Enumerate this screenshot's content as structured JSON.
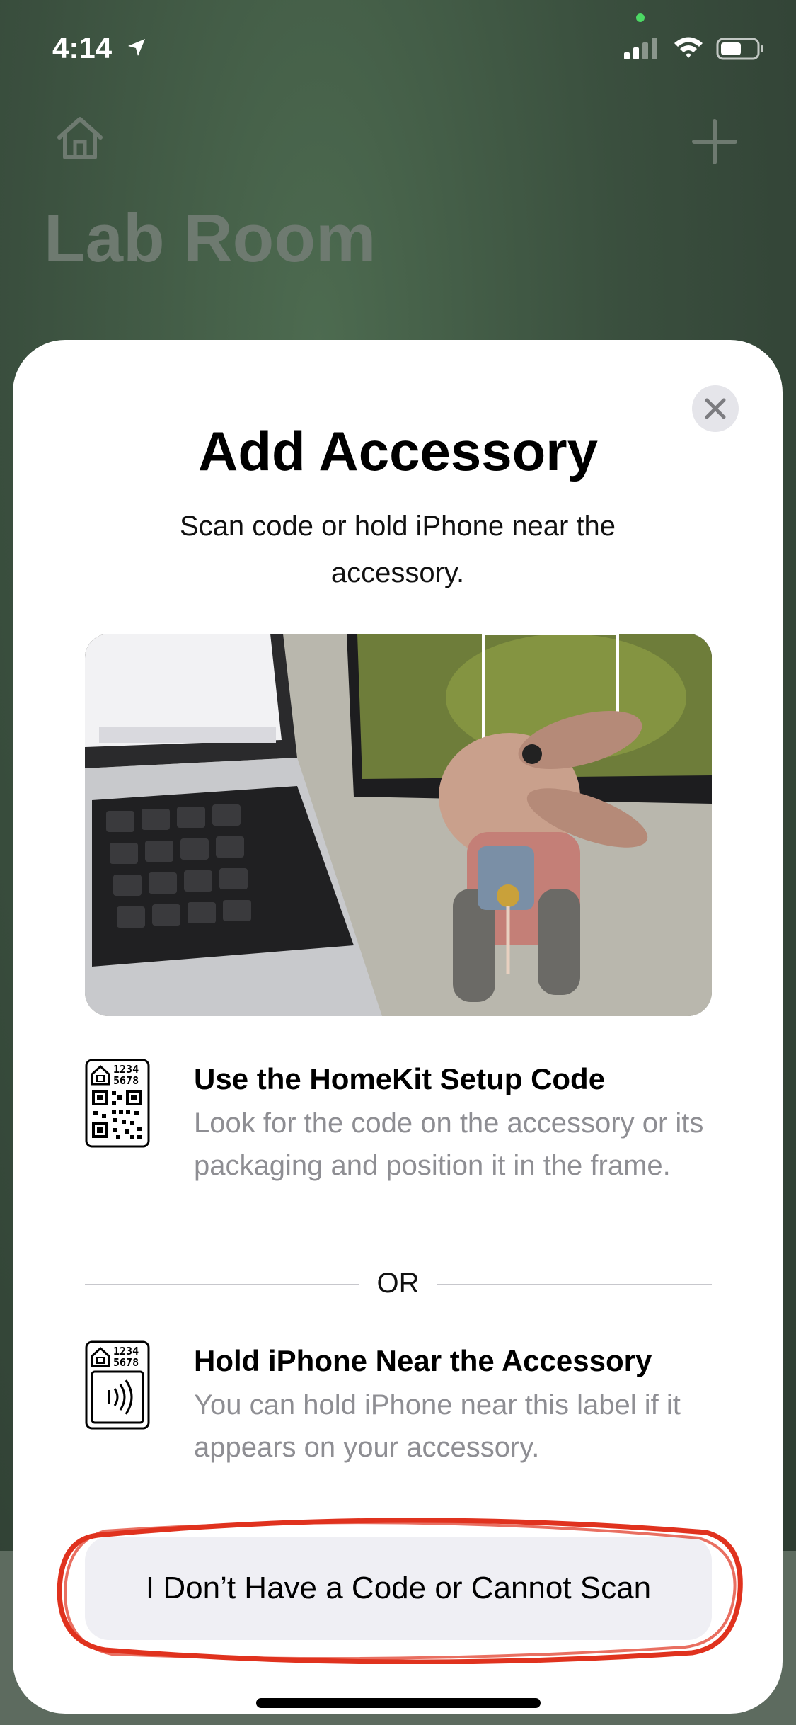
{
  "status_bar": {
    "time": "4:14"
  },
  "background": {
    "room_title": "Lab Room"
  },
  "sheet": {
    "title": "Add Accessory",
    "subtitle": "Scan code or hold iPhone near the accessory.",
    "option_setup_code": {
      "title": "Use the HomeKit Setup Code",
      "description": "Look for the code on the accessory or its packaging and position it in the frame.",
      "code_line1": "1234",
      "code_line2": "5678"
    },
    "or_label": "OR",
    "option_nfc": {
      "title": "Hold iPhone Near the Accessory",
      "description": "You can hold iPhone near this label if it appears on your accessory.",
      "code_line1": "1234",
      "code_line2": "5678"
    },
    "no_code_button": "I Don’t Have a Code or Cannot Scan"
  },
  "icons": {
    "home": "home-icon",
    "add": "plus-icon",
    "close": "close-icon",
    "location": "location-arrow-icon",
    "signal": "cellular-signal-icon",
    "wifi": "wifi-icon",
    "battery": "battery-icon",
    "qr": "homekit-qr-code-icon",
    "nfc": "homekit-nfc-tag-icon"
  },
  "colors": {
    "background": "#3b4f40",
    "sheet": "#ffffff",
    "button_fill": "#efeff4",
    "secondary_text": "#8e8e93",
    "annotation_red": "#e0321e"
  }
}
